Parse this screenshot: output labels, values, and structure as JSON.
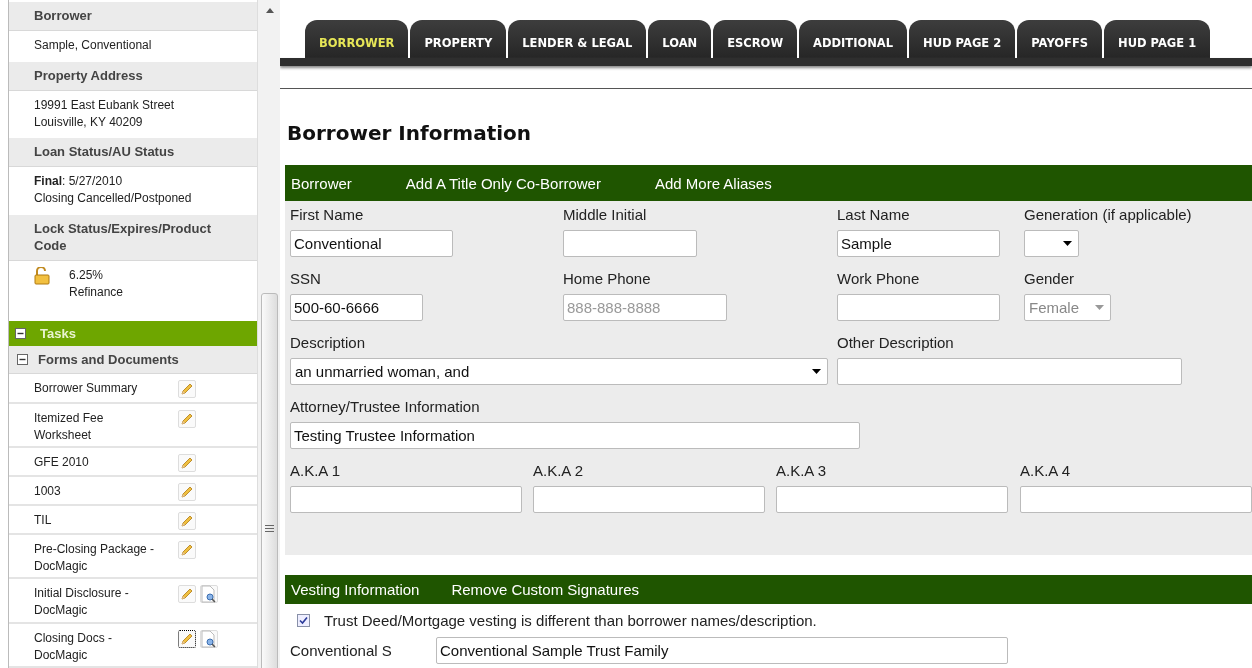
{
  "sidebar": {
    "sections": [
      {
        "heading": "Borrower",
        "kind": "text",
        "lines": [
          "Sample, Conventional"
        ]
      },
      {
        "heading": "Property Address",
        "kind": "text",
        "lines": [
          "19991 East Eubank Street",
          "Louisville, KY 40209"
        ]
      },
      {
        "heading": "Loan Status/AU Status",
        "kind": "text",
        "lines": [
          "**Final**: 5/27/2010",
          "Closing Cancelled/Postponed"
        ]
      },
      {
        "heading": "Lock Status/Expires/Product Code",
        "kind": "lock",
        "lines": [
          "6.25%",
          "Refinance"
        ]
      }
    ],
    "tasks": {
      "label": "Tasks",
      "expanded": true
    },
    "forms": {
      "label": "Forms and Documents",
      "expanded": true,
      "items": [
        {
          "label": "Borrower Summary",
          "preview": false,
          "focused": false
        },
        {
          "label": "Itemized Fee Worksheet",
          "preview": false,
          "focused": false
        },
        {
          "label": "GFE 2010",
          "preview": false,
          "focused": false
        },
        {
          "label": "1003",
          "preview": false,
          "focused": false
        },
        {
          "label": "TIL",
          "preview": false,
          "focused": false
        },
        {
          "label": "Pre-Closing Package - DocMagic",
          "preview": false,
          "focused": false
        },
        {
          "label": "Initial Disclosure - DocMagic",
          "preview": true,
          "focused": false
        },
        {
          "label": "Closing Docs - DocMagic",
          "preview": true,
          "focused": true
        }
      ]
    }
  },
  "tabs": [
    {
      "label": "BORROWER",
      "selected": true
    },
    {
      "label": "PROPERTY",
      "selected": false
    },
    {
      "label": "LENDER & LEGAL",
      "selected": false
    },
    {
      "label": "LOAN",
      "selected": false
    },
    {
      "label": "ESCROW",
      "selected": false
    },
    {
      "label": "ADDITIONAL",
      "selected": false
    },
    {
      "label": "HUD PAGE 2",
      "selected": false
    },
    {
      "label": "PAYOFFS",
      "selected": false
    },
    {
      "label": "HUD PAGE 1",
      "selected": false
    }
  ],
  "title": "Borrower Information",
  "borrower_bar": [
    "Borrower",
    "Add A Title Only Co-Borrower",
    "Add More Aliases"
  ],
  "form_rows": [
    {
      "kind": "fields",
      "fields": [
        {
          "label": "First Name",
          "kind": "input",
          "value": "Conventional"
        },
        {
          "label": "Middle Initial",
          "kind": "input"
        },
        {
          "label": "Last Name",
          "kind": "input",
          "value": "Sample"
        },
        {
          "label": "Generation (if applicable)",
          "kind": "select",
          "disabled": false
        }
      ]
    },
    {
      "kind": "fields",
      "fields": [
        {
          "label": "SSN",
          "kind": "input",
          "value": "500-60-6666"
        },
        {
          "label": "Home Phone",
          "kind": "input",
          "placeholder": "888-888-8888"
        },
        {
          "label": "Work Phone",
          "kind": "input"
        },
        {
          "label": "Gender",
          "kind": "select",
          "value": "Female",
          "disabled": true
        }
      ]
    },
    {
      "kind": "fields",
      "fields": [
        {
          "label": "Description",
          "kind": "select",
          "value": "an unmarried woman, and",
          "disabled": false
        },
        {
          "label": "Other Description",
          "kind": "input"
        }
      ]
    },
    {
      "kind": "fields",
      "fields": [
        {
          "label": "Attorney/Trustee Information",
          "kind": "input",
          "value": "Testing Trustee Information"
        }
      ]
    },
    {
      "kind": "aka",
      "fields": [
        {
          "label": "A.K.A 1",
          "kind": "input"
        },
        {
          "label": "A.K.A 2",
          "kind": "input"
        },
        {
          "label": "A.K.A 3",
          "kind": "input"
        },
        {
          "label": "A.K.A 4",
          "kind": "input"
        }
      ]
    }
  ],
  "vesting_bar": [
    "Vesting Information",
    "Remove Custom Signatures"
  ],
  "vesting": {
    "checkbox": {
      "label": "Trust Deed/Mortgage vesting is different than borrower names/description.",
      "checked": true
    },
    "field": {
      "label": "Conventional S",
      "value": "Conventional Sample Trust Family"
    }
  }
}
